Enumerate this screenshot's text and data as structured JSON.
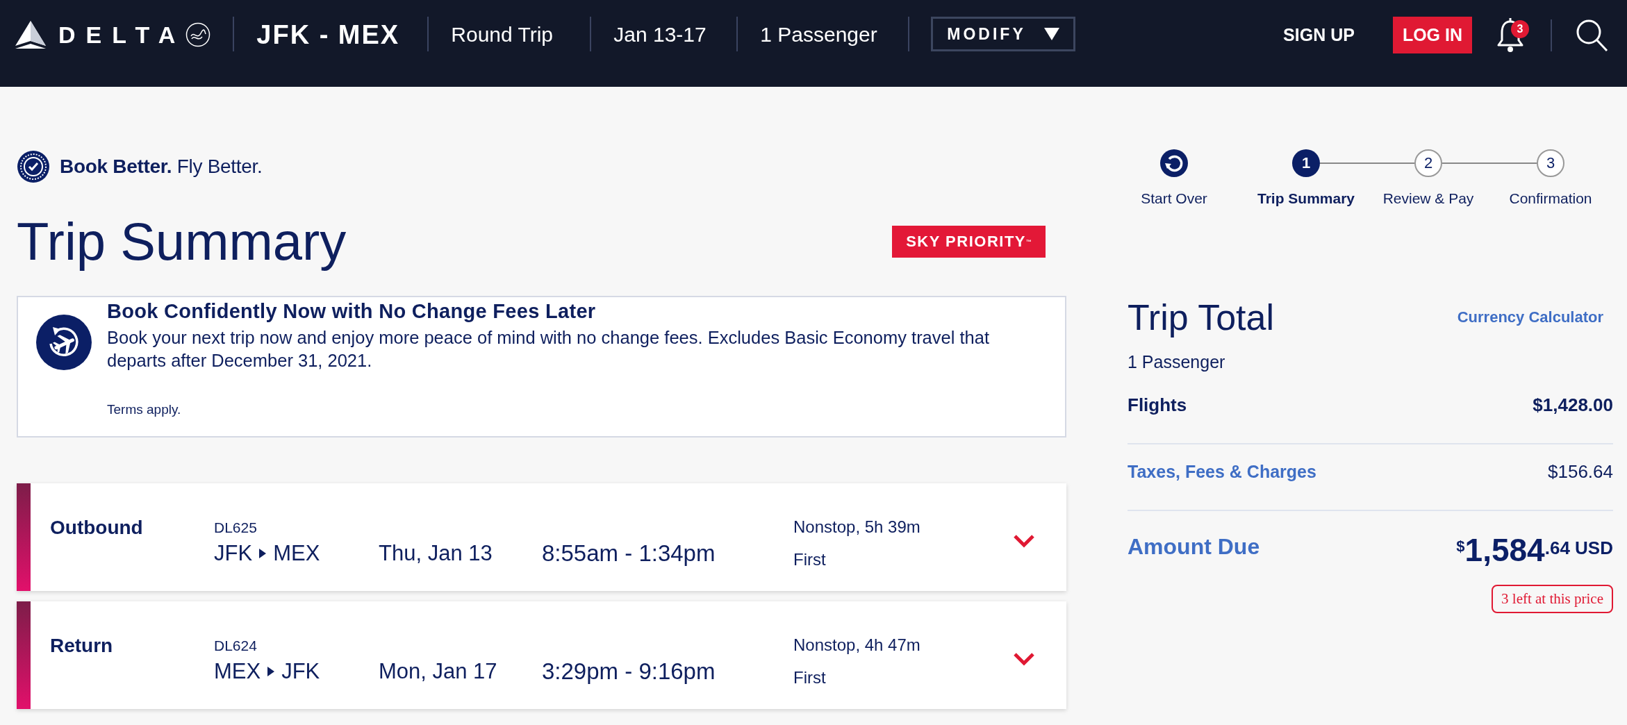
{
  "header": {
    "logo_text": "DELTA",
    "route": "JFK - MEX",
    "trip_type": "Round Trip",
    "dates": "Jan 13-17",
    "passengers": "1 Passenger",
    "modify_button": "MODIFY",
    "sign_up": "SIGN UP",
    "log_in": "LOG IN",
    "notification_count": "3"
  },
  "tagline": "**Book Better.** Fly Better.",
  "title": "Trip Summary",
  "badge": "SKY PRIORITY$^{™}$",
  "notice": {
    "title": "Book Confidently Now with No Change Fees Later",
    "body": "Book your next trip now and enjoy more peace of mind with no change fees. Excludes Basic Economy travel that departs after December 31, 2021.",
    "terms": "Terms apply."
  },
  "flights": [
    {
      "direction": "Outbound",
      "flight_number": "DL625",
      "origin": "JFK",
      "destination": "MEX",
      "date": "Thu, Jan 13",
      "times": "8:55am - 1:34pm",
      "duration": "Nonstop, 5h 39m",
      "cabin": "First"
    },
    {
      "direction": "Return",
      "flight_number": "DL624",
      "origin": "MEX",
      "destination": "JFK",
      "date": "Mon, Jan 17",
      "times": "3:29pm - 9:16pm",
      "duration": "Nonstop, 4h 47m",
      "cabin": "First"
    }
  ],
  "progress": {
    "start_over": "Start Over",
    "steps": [
      {
        "number": "1",
        "label": "Trip Summary",
        "selected": true
      },
      {
        "number": "2",
        "label": "Review & Pay",
        "selected": false
      },
      {
        "number": "3",
        "label": "Confirmation",
        "selected": false
      }
    ]
  },
  "trip_total": {
    "title": "Trip Total",
    "currency_calculator": "Currency Calculator",
    "passengers": "1 Passenger",
    "lines": [
      {
        "kind": "plain",
        "label": "Flights",
        "amount": "$1,428.00"
      },
      {
        "kind": "link",
        "label": "Taxes, Fees & Charges",
        "amount": "$156.64"
      }
    ],
    "amount_due": {
      "label": "Amount Due",
      "symbol": "$",
      "whole": "1,584",
      "fraction": ".64",
      "currency": "USD"
    },
    "availability": "3 left at this price"
  }
}
